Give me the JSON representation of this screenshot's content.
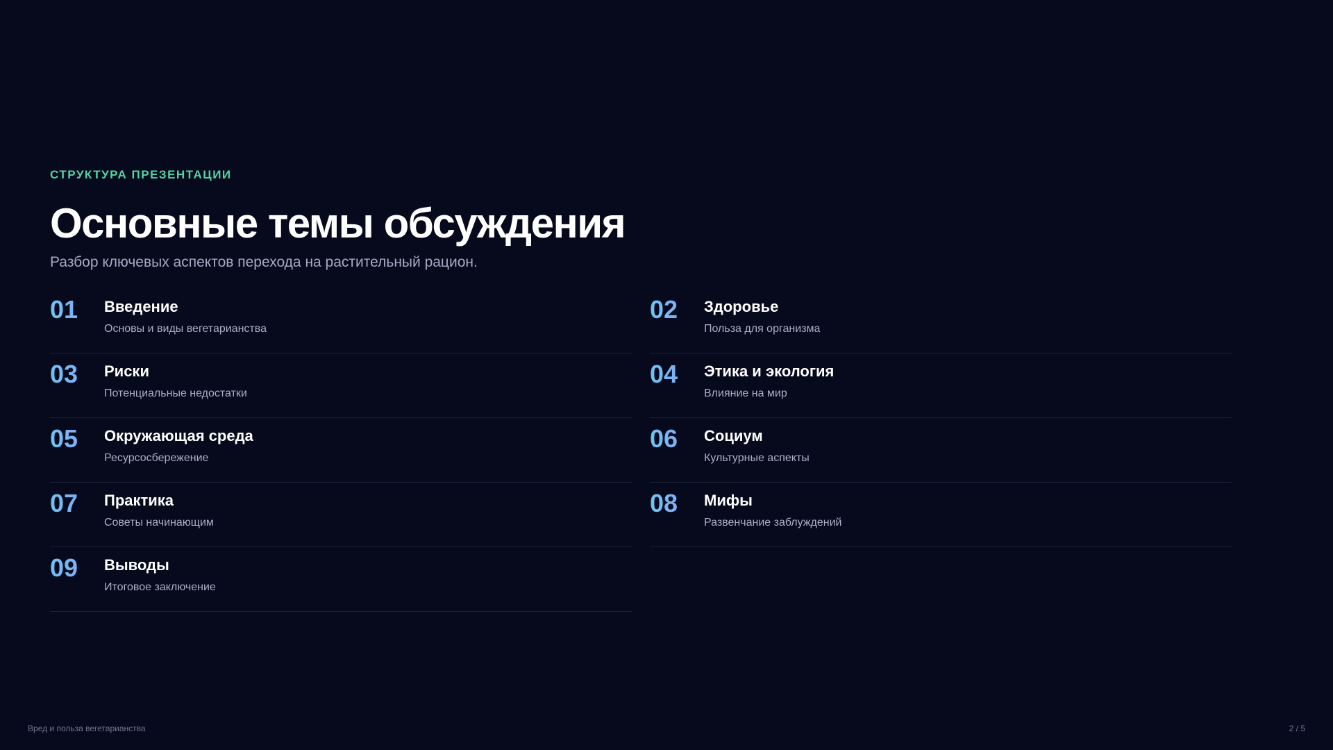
{
  "header": {
    "eyebrow": "СТРУКТУРА ПРЕЗЕНТАЦИИ",
    "title": "Основные темы обсуждения",
    "subtitle": "Разбор ключевых аспектов перехода на растительный рацион."
  },
  "topics": [
    {
      "num": "01",
      "title": "Введение",
      "desc": "Основы и виды вегетарианства"
    },
    {
      "num": "02",
      "title": "Здоровье",
      "desc": "Польза для организма"
    },
    {
      "num": "03",
      "title": "Риски",
      "desc": "Потенциальные недостатки"
    },
    {
      "num": "04",
      "title": "Этика и экология",
      "desc": "Влияние на мир"
    },
    {
      "num": "05",
      "title": "Окружающая среда",
      "desc": "Ресурсосбережение"
    },
    {
      "num": "06",
      "title": "Социум",
      "desc": "Культурные аспекты"
    },
    {
      "num": "07",
      "title": "Практика",
      "desc": "Советы начинающим"
    },
    {
      "num": "08",
      "title": "Мифы",
      "desc": "Развенчание заблуждений"
    },
    {
      "num": "09",
      "title": "Выводы",
      "desc": "Итоговое заключение"
    }
  ],
  "footer": {
    "deck_title": "Вред и польза вегетарианства",
    "page_indicator": "2 / 5"
  },
  "colors": {
    "background": "#070a1c",
    "accent_eyebrow": "#4fd6a6",
    "number_gradient_start": "#6ec2f4",
    "number_gradient_end": "#8f9cf4"
  }
}
